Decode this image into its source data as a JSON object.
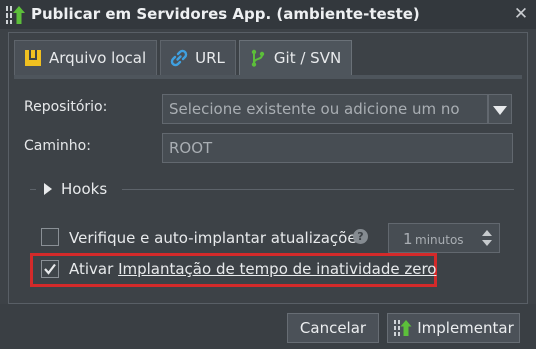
{
  "dialog": {
    "title": "Publicar em Servidores App. (ambiente-teste)",
    "title_icon": "deploy-icon",
    "close_icon": "close-icon"
  },
  "tabs": [
    {
      "label": "Arquivo local",
      "icon": "archive-icon",
      "active": false
    },
    {
      "label": "URL",
      "icon": "link-icon",
      "active": false
    },
    {
      "label": "Git / SVN",
      "icon": "git-branch-icon",
      "active": true
    }
  ],
  "form": {
    "repository_label": "Repositório:",
    "repository_placeholder": "Selecione existente ou adicione um no",
    "path_label": "Caminho:",
    "path_value": "ROOT",
    "hooks_label": "Hooks",
    "auto_update_label": "Verifique e auto-implantar atualizações",
    "auto_update_checked": false,
    "interval_value": "1",
    "interval_unit": "minutos",
    "zero_downtime_prefix": "Ativar ",
    "zero_downtime_link": "Implantação de tempo de inatividade zero",
    "zero_downtime_checked": true
  },
  "footer": {
    "cancel_label": "Cancelar",
    "deploy_label": "Implementar"
  },
  "colors": {
    "accent_green": "#5cbf3a",
    "link_blue": "#3fa0e0",
    "archive_yellow": "#f0c020",
    "highlight_red": "#d42a2a"
  }
}
